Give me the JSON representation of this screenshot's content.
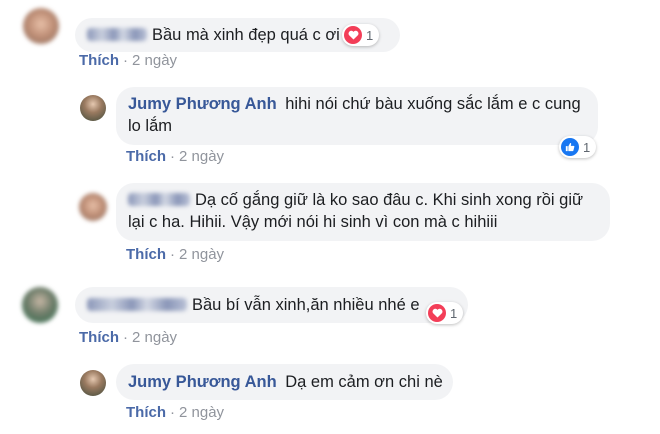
{
  "comments": [
    {
      "author_blurred": true,
      "text": "Bầu mà xinh đẹp quá c ơi",
      "reaction": {
        "icon": "heart-icon",
        "count": "1"
      },
      "like_label": "Thích",
      "time": "2 ngày"
    },
    {
      "author": "Jumy Phương Anh",
      "text": "hihi nói chứ bàu xuống sắc lắm e c cung lo lắm",
      "reaction": {
        "icon": "thumbs-up-icon",
        "count": "1"
      },
      "like_label": "Thích",
      "time": "2 ngày"
    },
    {
      "author_blurred": true,
      "text": "Dạ cố gắng giữ là ko sao đâu c. Khi sinh xong rồi giữ lại c ha. Hihii. Vậy mới nói hi sinh vì con mà c hihiii",
      "like_label": "Thích",
      "time": "2 ngày"
    },
    {
      "author_blurred": true,
      "text": "Bầu bí vẫn xinh,ăn nhiều nhé e",
      "reaction": {
        "icon": "heart-icon",
        "count": "1"
      },
      "like_label": "Thích",
      "time": "2 ngày"
    },
    {
      "author": "Jumy Phương Anh",
      "text": "Dạ em cảm ơn chi nè",
      "like_label": "Thích",
      "time": "2 ngày"
    }
  ],
  "colors": {
    "bubble": "#f2f3f5",
    "name": "#385898",
    "meta": "#90949c",
    "heart": "#f33e58",
    "like": "#1877f2"
  }
}
